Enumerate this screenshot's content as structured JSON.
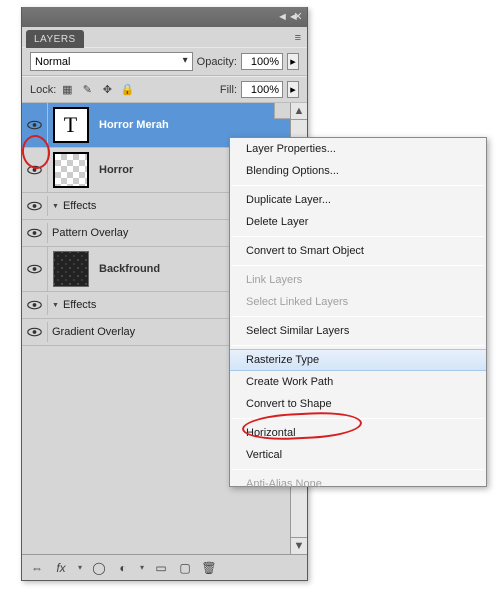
{
  "panel": {
    "title": "LAYERS",
    "blend_mode": "Normal",
    "opacity_label": "Opacity:",
    "opacity_value": "100%",
    "lock_label": "Lock:",
    "fill_label": "Fill:",
    "fill_value": "100%"
  },
  "layers": [
    {
      "name": "Horror Merah",
      "type": "text",
      "selected": true,
      "visible": true
    },
    {
      "name": "Horror",
      "type": "raster",
      "selected": false,
      "visible": true,
      "effects_label": "Effects",
      "sub_effects": [
        "Pattern Overlay"
      ]
    },
    {
      "name": "Backfround",
      "type": "background",
      "selected": false,
      "visible": true,
      "effects_label": "Effects",
      "sub_effects": [
        "Gradient Overlay"
      ]
    }
  ],
  "context_menu": {
    "items": [
      {
        "label": "Layer Properties..."
      },
      {
        "label": "Blending Options..."
      },
      {
        "sep": true
      },
      {
        "label": "Duplicate Layer..."
      },
      {
        "label": "Delete Layer"
      },
      {
        "sep": true
      },
      {
        "label": "Convert to Smart Object"
      },
      {
        "sep": true
      },
      {
        "label": "Link Layers",
        "disabled": true
      },
      {
        "label": "Select Linked Layers",
        "disabled": true
      },
      {
        "sep": true
      },
      {
        "label": "Select Similar Layers"
      },
      {
        "sep": true
      },
      {
        "label": "Rasterize Type",
        "hover": true
      },
      {
        "label": "Create Work Path"
      },
      {
        "label": "Convert to Shape"
      },
      {
        "sep": true
      },
      {
        "label": "Horizontal"
      },
      {
        "label": "Vertical"
      },
      {
        "sep": true
      },
      {
        "label": "Anti-Alias None",
        "disabled": true,
        "cut": true
      }
    ]
  },
  "icons": {
    "collapse_left": "◄◄",
    "collapse_close": "✕",
    "menu_lines": "≡",
    "lock_trans": "▦",
    "lock_brush": "✎",
    "lock_move": "✥",
    "lock_all": "🔒",
    "stepper": "▸",
    "up": "▲",
    "down": "▼",
    "link": "⇔",
    "fx": "fx",
    "mask": "◯",
    "adjust": "◐",
    "folder": "▭",
    "new": "▢",
    "trash": "🗑",
    "type_t": "T"
  }
}
